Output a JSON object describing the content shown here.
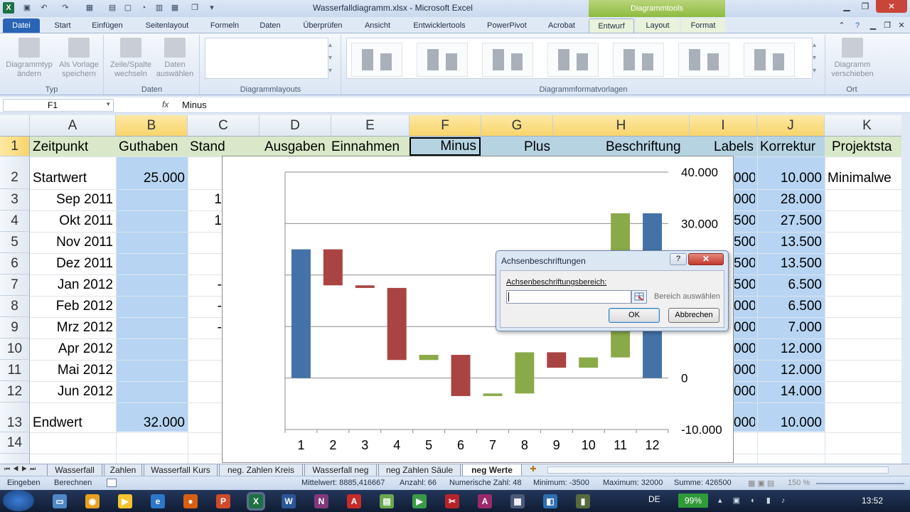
{
  "window": {
    "title": "Wasserfalldiagramm.xlsx - Microsoft Excel",
    "app_icon": "X",
    "context_tab_group": "Diagrammtools"
  },
  "ribbon_tabs": [
    "Datei",
    "Start",
    "Einfügen",
    "Seitenlayout",
    "Formeln",
    "Daten",
    "Überprüfen",
    "Ansicht",
    "Entwicklertools",
    "PowerPivot",
    "Acrobat",
    "Entwurf",
    "Layout",
    "Format"
  ],
  "ribbon": {
    "groups": {
      "typ": "Typ",
      "daten": "Daten",
      "layouts": "Diagrammlayouts",
      "formatvorlagen": "Diagrammformatvorlagen",
      "ort": "Ort"
    },
    "buttons": {
      "change_type": "Diagrammtyp ändern",
      "save_template": "Als Vorlage speichern",
      "switch_rowcol": "Zeile/Spalte wechseln",
      "select_data": "Daten auswählen",
      "move_chart": "Diagramm verschieben"
    }
  },
  "formula_bar": {
    "name_box": "F1",
    "fx": "fx",
    "content": "Minus"
  },
  "columns": [
    "A",
    "B",
    "C",
    "D",
    "E",
    "F",
    "G",
    "H",
    "I",
    "J",
    "K"
  ],
  "rows": [
    "1",
    "2",
    "3",
    "4",
    "5",
    "6",
    "7",
    "8",
    "9",
    "10",
    "11",
    "12",
    "13",
    "14"
  ],
  "headers": {
    "A": "Zeitpunkt",
    "B": "Guthaben",
    "C": "Stand",
    "D": "Ausgaben",
    "E": "Einnahmen",
    "F": "Minus",
    "G": "Plus",
    "H": "Beschriftung",
    "I": "Labels",
    "J": "Korrektur",
    "K": "Projektsta"
  },
  "col_a": [
    "Startwert",
    "Sep 2011",
    "Okt 2011",
    "Nov 2011",
    "Dez 2011",
    "Jan 2012",
    "Feb 2012",
    "Mrz 2012",
    "Apr 2012",
    "Mai 2012",
    "Jun 2012",
    "Endwert"
  ],
  "col_b": {
    "start": "25.000",
    "end": "32.000"
  },
  "col_c_partial": [
    "1",
    "1",
    "-",
    "-",
    "-"
  ],
  "col_i_partial": [
    "000",
    "000",
    "500",
    "500",
    "500",
    "500",
    "000",
    "000",
    "000",
    "000",
    "000",
    "000"
  ],
  "col_j": [
    "10.000",
    "28.000",
    "27.500",
    "13.500",
    "13.500",
    "6.500",
    "6.500",
    "7.000",
    "12.000",
    "12.000",
    "14.000",
    "10.000"
  ],
  "col_k": "Minimalwe",
  "chart_data": {
    "type": "bar",
    "categories": [
      "1",
      "2",
      "3",
      "4",
      "5",
      "6",
      "7",
      "8",
      "9",
      "10",
      "11",
      "12"
    ],
    "ylim": [
      -10000,
      40000
    ],
    "y_ticks": [
      "40.000",
      "30.000",
      "",
      "",
      "",
      "0",
      "-10.000"
    ],
    "y_ticks_visible": [
      {
        "label": "40.000",
        "value": 40000
      },
      {
        "label": "30.000",
        "value": 30000
      },
      {
        "label": "0",
        "value": 0
      },
      {
        "label": "-10.000",
        "value": -10000
      }
    ],
    "grid": true,
    "bars": [
      {
        "category": "1",
        "low": 0,
        "high": 25000,
        "color": "#4472a8"
      },
      {
        "category": "2",
        "low": 18000,
        "high": 25000,
        "color": "#a94442"
      },
      {
        "category": "3",
        "low": 17500,
        "high": 18000,
        "color": "#a94442"
      },
      {
        "category": "4",
        "low": 3500,
        "high": 17500,
        "color": "#a94442"
      },
      {
        "category": "5",
        "low": 3500,
        "high": 4500,
        "color": "#8aaa4a"
      },
      {
        "category": "6",
        "low": -3500,
        "high": 4500,
        "color": "#a94442"
      },
      {
        "category": "7",
        "low": -3500,
        "high": -3000,
        "color": "#8aaa4a"
      },
      {
        "category": "8",
        "low": -3000,
        "high": 5000,
        "color": "#8aaa4a"
      },
      {
        "category": "9",
        "low": 2000,
        "high": 5000,
        "color": "#a94442"
      },
      {
        "category": "10",
        "low": 2000,
        "high": 4000,
        "color": "#8aaa4a"
      },
      {
        "category": "11",
        "low": 4000,
        "high": 32000,
        "color": "#8aaa4a"
      },
      {
        "category": "12",
        "low": 0,
        "high": 32000,
        "color": "#4472a8"
      }
    ]
  },
  "dialog": {
    "title": "Achsenbeschriftungen",
    "help": "?",
    "close": "✕",
    "field_label": "Achsenbeschriftungsbereich:",
    "field_value": "",
    "hint": "Bereich auswählen",
    "ok": "OK",
    "cancel": "Abbrechen"
  },
  "sheet_tabs": [
    "Wasserfall",
    "Zahlen",
    "Wasserfall Kurs",
    "neg. Zahlen Kreis",
    "Wasserfall neg",
    "neg Zahlen Säule",
    "neg Werte"
  ],
  "status": {
    "mode": "Eingeben",
    "calc": "Berechnen",
    "avg": "Mittelwert: 8885,416667",
    "count": "Anzahl: 66",
    "numcount": "Numerische Zahl: 48",
    "min": "Minimum: -3500",
    "max": "Maximum: 32000",
    "sum": "Summe: 426500",
    "zoom": "150 %"
  },
  "taskbar": {
    "lang": "DE",
    "battery": "99%",
    "clock": "13:52"
  },
  "colors": {
    "blue_bar": "#4472a8",
    "red_bar": "#a94442",
    "green_bar": "#8aaa4a"
  }
}
